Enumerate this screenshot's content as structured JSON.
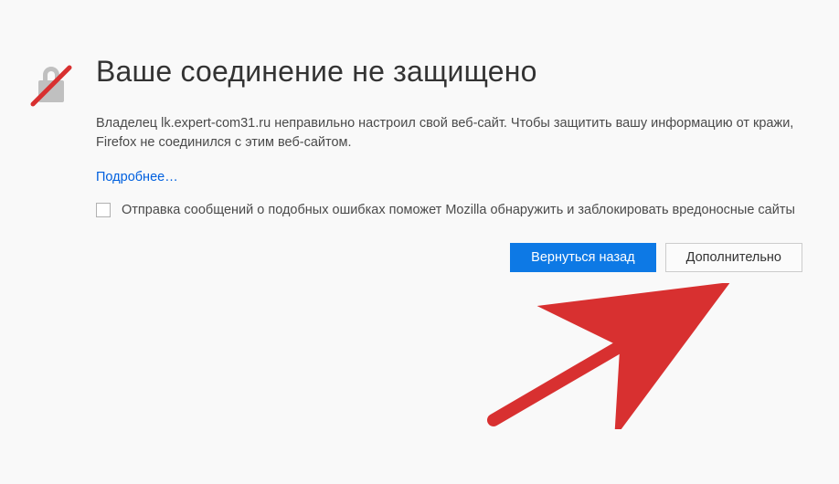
{
  "title": "Ваше соединение не защищено",
  "description": "Владелец lk.expert-com31.ru неправильно настроил свой веб-сайт. Чтобы защитить вашу информацию от кражи, Firefox не соединился с этим веб-сайтом.",
  "more_link": "Подробнее…",
  "report_label": "Отправка сообщений о подобных ошибках поможет Mozilla обнаружить и заблокировать вредоносные сайты",
  "buttons": {
    "back": "Вернуться назад",
    "advanced": "Дополнительно"
  }
}
